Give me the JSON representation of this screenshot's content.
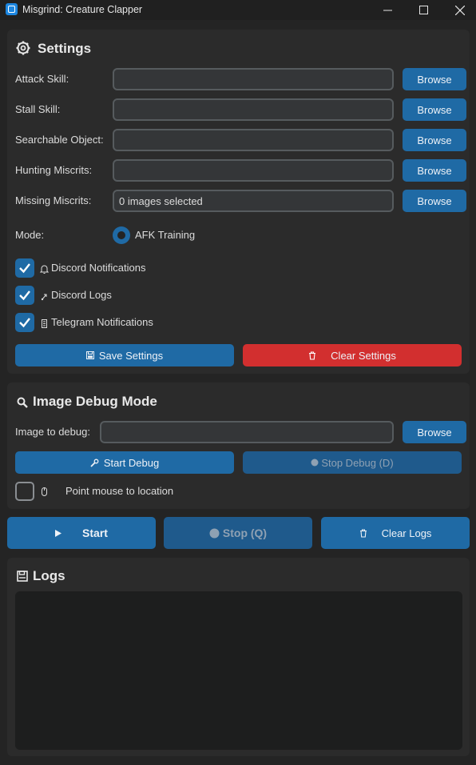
{
  "window": {
    "title": "Misgrind: Creature Clapper"
  },
  "settings": {
    "title": "Settings",
    "fields": [
      {
        "label": "Attack Skill:",
        "value": "",
        "button": "Browse"
      },
      {
        "label": "Stall Skill:",
        "value": "",
        "button": "Browse"
      },
      {
        "label": "Searchable Object:",
        "value": "",
        "button": "Browse"
      },
      {
        "label": "Hunting Miscrits:",
        "value": "",
        "button": "Browse"
      },
      {
        "label": "Missing Miscrits:",
        "value": "0 images selected",
        "button": "Browse"
      }
    ],
    "mode": {
      "label": "Mode:",
      "option": "AFK Training",
      "selected": true
    },
    "checkboxes": [
      {
        "label": "Discord Notifications",
        "icon": "bell-icon",
        "checked": true
      },
      {
        "label": "Discord Logs",
        "icon": "link-icon",
        "checked": true
      },
      {
        "label": "Telegram Notifications",
        "icon": "document-icon",
        "checked": true
      }
    ],
    "save_button": "Save Settings",
    "clear_button": "Clear Settings"
  },
  "debug": {
    "title": "Image Debug Mode",
    "image_label": "Image to debug:",
    "image_value": "",
    "browse": "Browse",
    "start": "Start Debug",
    "stop": "Stop Debug (D)",
    "point_mouse": {
      "label": "Point mouse to location",
      "checked": false
    }
  },
  "controls": {
    "start": "Start",
    "stop": "Stop (Q)",
    "clear_logs": "Clear Logs"
  },
  "logs": {
    "title": "Logs",
    "content": ""
  },
  "colors": {
    "accent": "#1f6aa5",
    "danger": "#d22f2f",
    "panel": "#2b2b2b",
    "background": "#242424"
  }
}
